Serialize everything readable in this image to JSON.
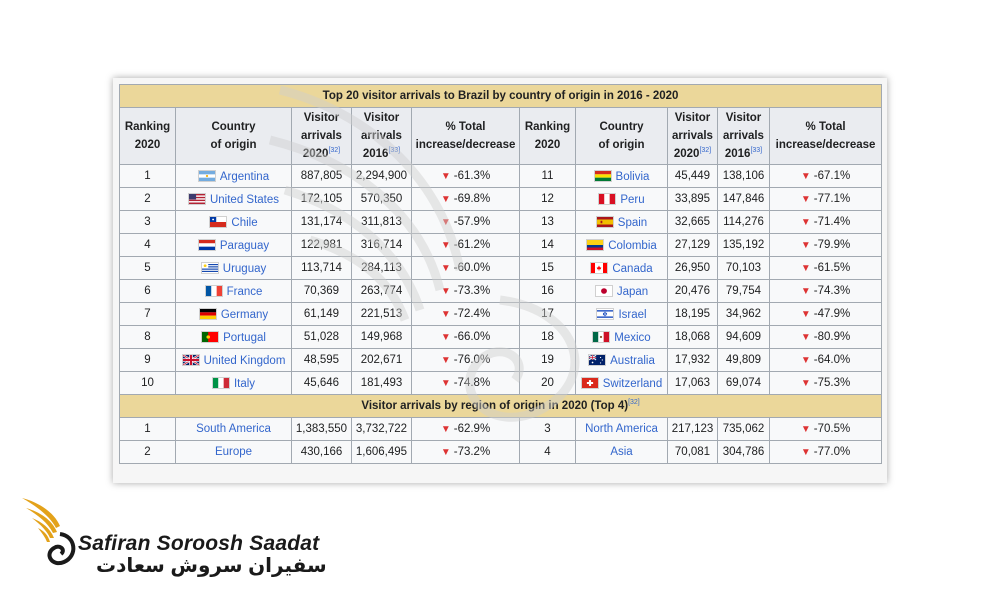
{
  "table": {
    "caption": "Top 20 visitor arrivals to Brazil by country of origin in 2016 - 2020",
    "headers": {
      "ranking": [
        "Ranking",
        "2020"
      ],
      "country": [
        "Country",
        "of origin"
      ],
      "arrivals_2020": [
        "Visitor",
        "arrivals",
        "2020"
      ],
      "arrivals_2020_ref": "[32]",
      "arrivals_2016": [
        "Visitor",
        "arrivals",
        "2016"
      ],
      "arrivals_2016_ref": "[33]",
      "pct": [
        "% Total",
        "increase/decrease"
      ]
    },
    "rows": [
      {
        "left": {
          "rank": "1",
          "country": "Argentina",
          "flag": "argentina",
          "v2020": "887,805",
          "v2016": "2,294,900",
          "pct": "-61.3%"
        },
        "right": {
          "rank": "11",
          "country": "Bolivia",
          "flag": "bolivia",
          "v2020": "45,449",
          "v2016": "138,106",
          "pct": "-67.1%"
        }
      },
      {
        "left": {
          "rank": "2",
          "country": "United States",
          "flag": "usa",
          "v2020": "172,105",
          "v2016": "570,350",
          "pct": "-69.8%"
        },
        "right": {
          "rank": "12",
          "country": "Peru",
          "flag": "peru",
          "v2020": "33,895",
          "v2016": "147,846",
          "pct": "-77.1%"
        }
      },
      {
        "left": {
          "rank": "3",
          "country": "Chile",
          "flag": "chile",
          "v2020": "131,174",
          "v2016": "311,813",
          "pct": "-57.9%"
        },
        "right": {
          "rank": "13",
          "country": "Spain",
          "flag": "spain",
          "v2020": "32,665",
          "v2016": "114,276",
          "pct": "-71.4%"
        }
      },
      {
        "left": {
          "rank": "4",
          "country": "Paraguay",
          "flag": "paraguay",
          "v2020": "122,981",
          "v2016": "316,714",
          "pct": "-61.2%"
        },
        "right": {
          "rank": "14",
          "country": "Colombia",
          "flag": "colombia",
          "v2020": "27,129",
          "v2016": "135,192",
          "pct": "-79.9%"
        }
      },
      {
        "left": {
          "rank": "5",
          "country": "Uruguay",
          "flag": "uruguay",
          "v2020": "113,714",
          "v2016": "284,113",
          "pct": "-60.0%"
        },
        "right": {
          "rank": "15",
          "country": "Canada",
          "flag": "canada",
          "v2020": "26,950",
          "v2016": "70,103",
          "pct": "-61.5%"
        }
      },
      {
        "left": {
          "rank": "6",
          "country": "France",
          "flag": "france",
          "v2020": "70,369",
          "v2016": "263,774",
          "pct": "-73.3%"
        },
        "right": {
          "rank": "16",
          "country": "Japan",
          "flag": "japan",
          "v2020": "20,476",
          "v2016": "79,754",
          "pct": "-74.3%"
        }
      },
      {
        "left": {
          "rank": "7",
          "country": "Germany",
          "flag": "germany",
          "v2020": "61,149",
          "v2016": "221,513",
          "pct": "-72.4%"
        },
        "right": {
          "rank": "17",
          "country": "Israel",
          "flag": "israel",
          "v2020": "18,195",
          "v2016": "34,962",
          "pct": "-47.9%"
        }
      },
      {
        "left": {
          "rank": "8",
          "country": "Portugal",
          "flag": "portugal",
          "v2020": "51,028",
          "v2016": "149,968",
          "pct": "-66.0%"
        },
        "right": {
          "rank": "18",
          "country": "Mexico",
          "flag": "mexico",
          "v2020": "18,068",
          "v2016": "94,609",
          "pct": "-80.9%"
        }
      },
      {
        "left": {
          "rank": "9",
          "country": "United Kingdom",
          "flag": "uk",
          "v2020": "48,595",
          "v2016": "202,671",
          "pct": "-76.0%"
        },
        "right": {
          "rank": "19",
          "country": "Australia",
          "flag": "australia",
          "v2020": "17,932",
          "v2016": "49,809",
          "pct": "-64.0%"
        }
      },
      {
        "left": {
          "rank": "10",
          "country": "Italy",
          "flag": "italy",
          "v2020": "45,646",
          "v2016": "181,493",
          "pct": "-74.8%"
        },
        "right": {
          "rank": "20",
          "country": "Switzerland",
          "flag": "switzerland",
          "v2020": "17,063",
          "v2016": "69,074",
          "pct": "-75.3%"
        }
      }
    ],
    "region_caption": "Visitor arrivals by region of origin in 2020 (Top 4)",
    "region_caption_ref": "[32]",
    "region_rows": [
      {
        "left": {
          "rank": "1",
          "region": "South America",
          "v2020": "1,383,550",
          "v2016": "3,732,722",
          "pct": "-62.9%"
        },
        "right": {
          "rank": "3",
          "region": "North America",
          "v2020": "217,123",
          "v2016": "735,062",
          "pct": "-70.5%"
        }
      },
      {
        "left": {
          "rank": "2",
          "region": "Europe",
          "v2020": "430,166",
          "v2016": "1,606,495",
          "pct": "-73.2%"
        },
        "right": {
          "rank": "4",
          "region": "Asia",
          "v2020": "70,081",
          "v2016": "304,786",
          "pct": "-77.0%"
        }
      }
    ],
    "decrease_icon": "red-down-triangle",
    "colors": {
      "caption_bg": "#ebd79a",
      "header_bg": "#eaecf0",
      "link": "#3366cc",
      "decrease": "#dd3333"
    }
  },
  "brand": {
    "name_en": "Safiran Soroosh Saadat",
    "name_fa": "سفیران سروش سعادت",
    "logo_icon": "golden-wing-bird-logo",
    "colors": {
      "gold": "#e3a21a",
      "text": "#1a1a1a"
    }
  }
}
